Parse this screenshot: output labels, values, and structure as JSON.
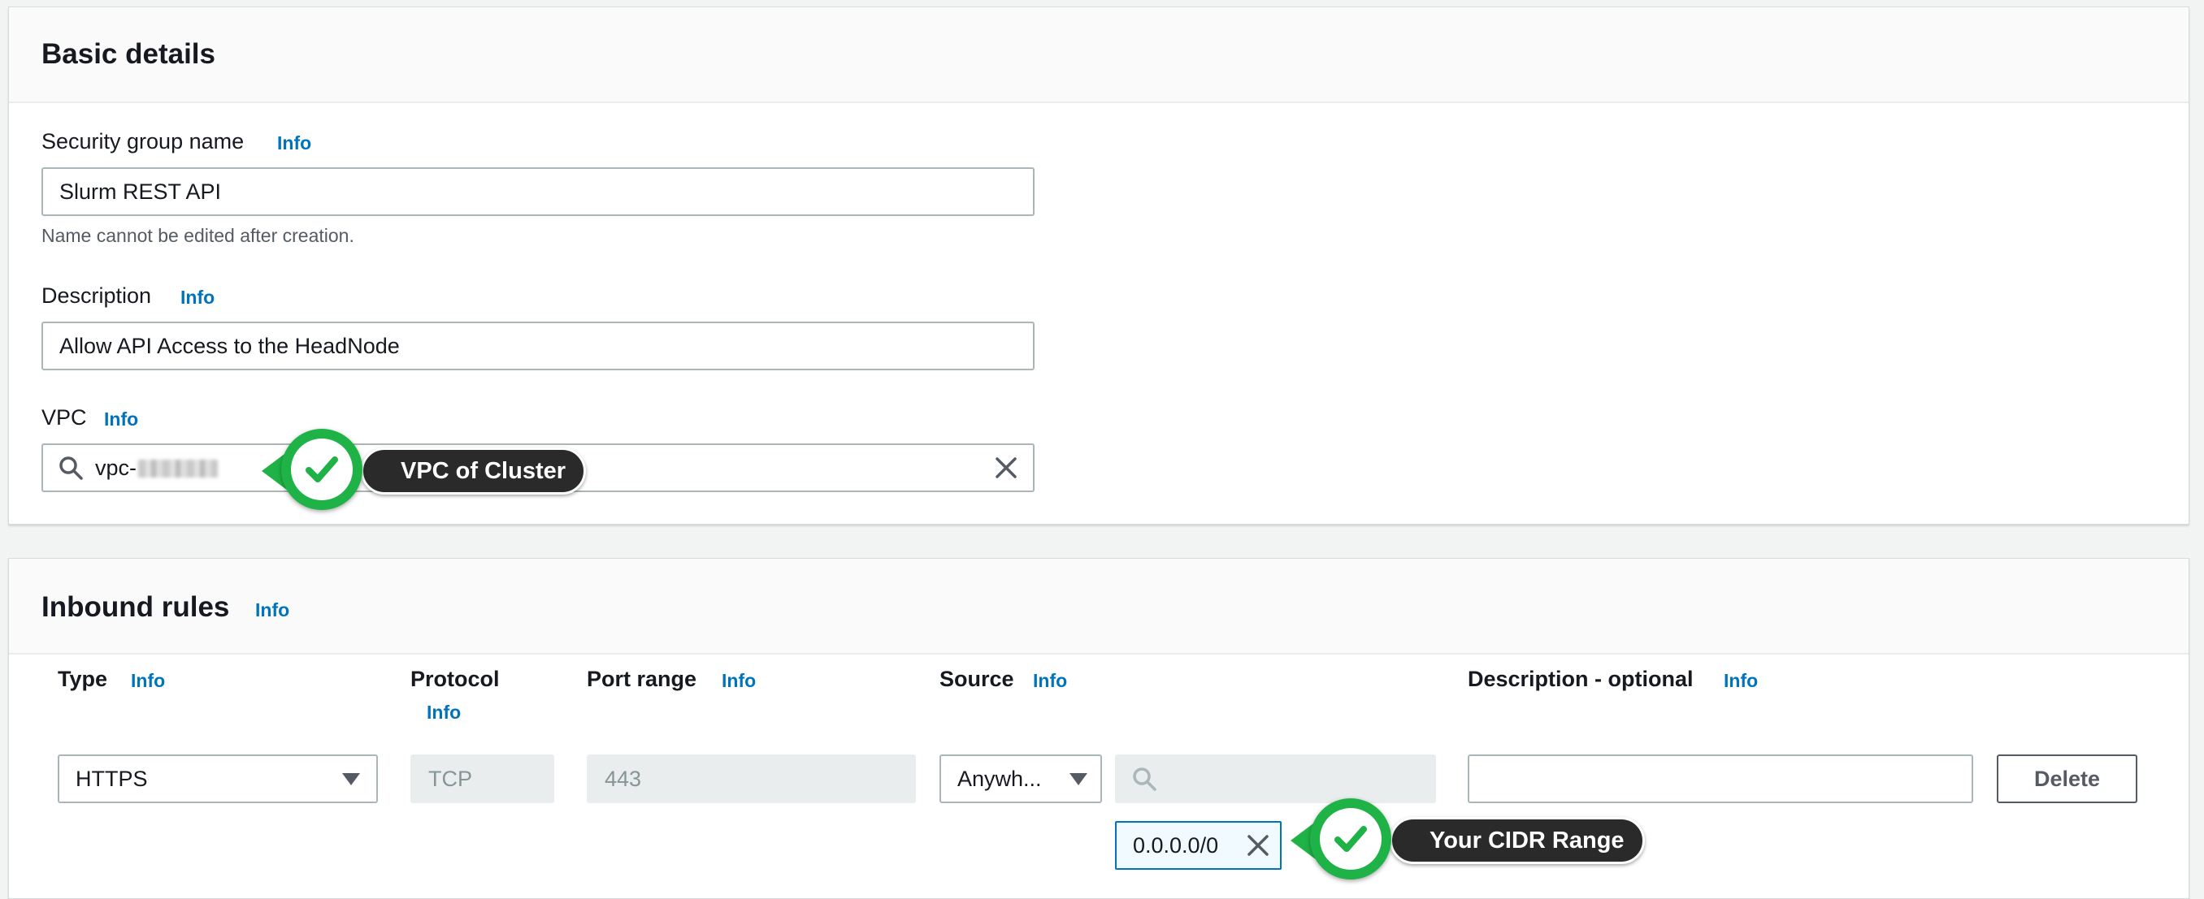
{
  "basic_details": {
    "title": "Basic details",
    "sg_name_label": "Security group name",
    "sg_name_info": "Info",
    "sg_name_value": "Slurm REST API",
    "sg_name_hint": "Name cannot be edited after creation.",
    "description_label": "Description",
    "description_info": "Info",
    "description_value": "Allow API Access to the HeadNode",
    "vpc_label": "VPC",
    "vpc_info": "Info",
    "vpc_value_prefix": "vpc-"
  },
  "inbound_rules": {
    "title": "Inbound rules",
    "title_info": "Info",
    "columns": {
      "type": "Type",
      "type_info": "Info",
      "protocol": "Protocol",
      "protocol_info": "Info",
      "port_range": "Port range",
      "port_range_info": "Info",
      "source": "Source",
      "source_info": "Info",
      "description": "Description - optional",
      "description_info": "Info"
    },
    "row": {
      "type_value": "HTTPS",
      "protocol_value": "TCP",
      "port_value": "443",
      "source_value": "Anywh...",
      "source_search_value": "",
      "cidr_token": "0.0.0.0/0",
      "description_value": "",
      "delete_label": "Delete"
    }
  },
  "callouts": {
    "vpc": "VPC of Cluster",
    "cidr": "Your CIDR Range"
  },
  "icons": {
    "search": "search-icon",
    "clear": "close-icon",
    "caret": "caret-down-icon",
    "check": "checkmark-icon"
  },
  "colors": {
    "link": "#0073bb",
    "callout_green": "#1fb347",
    "callout_dark": "#2a2a2a"
  }
}
